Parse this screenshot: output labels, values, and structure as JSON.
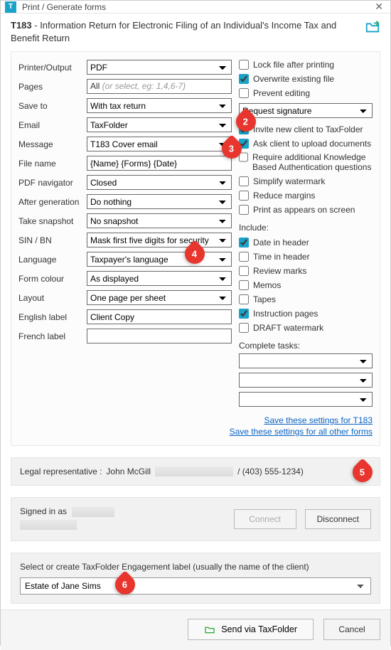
{
  "titlebar": {
    "title": "Print / Generate forms"
  },
  "header": {
    "form_code": "T183",
    "form_title": " - Information Return for Electronic Filing of an Individual's Income Tax and Benefit Return"
  },
  "left": {
    "printer_output": {
      "label": "Printer/Output",
      "value": "PDF"
    },
    "pages": {
      "label": "Pages",
      "prefix": "All ",
      "hint": "(or select, eg: 1,4,6-7)"
    },
    "save_to": {
      "label": "Save to",
      "value": "With tax return"
    },
    "email": {
      "label": "Email",
      "value": "TaxFolder"
    },
    "message": {
      "label": "Message",
      "value": "T183 Cover email"
    },
    "file_name": {
      "label": "File name",
      "value": "{Name} {Forms} {Date}"
    },
    "pdf_nav": {
      "label": "PDF navigator",
      "value": "Closed"
    },
    "after_gen": {
      "label": "After generation",
      "value": "Do nothing"
    },
    "snapshot": {
      "label": "Take snapshot",
      "value": "No snapshot"
    },
    "sin_bn": {
      "label": "SIN / BN",
      "value": "Mask first five digits for security"
    },
    "language": {
      "label": "Language",
      "value": "Taxpayer's language"
    },
    "form_colour": {
      "label": "Form colour",
      "value": "As displayed"
    },
    "layout": {
      "label": "Layout",
      "value": "One page per sheet"
    },
    "eng_label": {
      "label": "English label",
      "value": "Client Copy"
    },
    "fr_label": {
      "label": "French label",
      "value": ""
    }
  },
  "right": {
    "lock": "Lock file after printing",
    "overwrite": "Overwrite existing file",
    "prevent": "Prevent editing",
    "req_sig": "Request signature",
    "invite": "Invite new client to TaxFolder",
    "ask_upload": "Ask client to upload documents",
    "kba": "Require additional Knowledge Based Authentication questions",
    "simplify": "Simplify watermark",
    "reduce": "Reduce margins",
    "print_asis": "Print as appears on screen",
    "include_head": "Include:",
    "date_hdr": "Date in header",
    "time_hdr": "Time in header",
    "review": "Review marks",
    "memos": "Memos",
    "tapes": "Tapes",
    "instr": "Instruction pages",
    "draft": "DRAFT watermark",
    "tasks_head": "Complete tasks:"
  },
  "links": {
    "save_t183": "Save these settings for T183",
    "save_all": "Save these settings for all other forms"
  },
  "legal": {
    "label": "Legal representative  :  ",
    "name": "John McGill",
    "phone": " / (403) 555-1234)"
  },
  "signin": {
    "label": "Signed in as",
    "connect": "Connect",
    "disconnect": "Disconnect"
  },
  "engagement": {
    "prompt": "Select or create TaxFolder Engagement label (usually the name of the client)",
    "value": "Estate of Jane Sims"
  },
  "footer": {
    "send": "Send via TaxFolder",
    "cancel": "Cancel"
  },
  "callouts": {
    "c2": "2",
    "c3": "3",
    "c4": "4",
    "c5": "5",
    "c6": "6"
  }
}
